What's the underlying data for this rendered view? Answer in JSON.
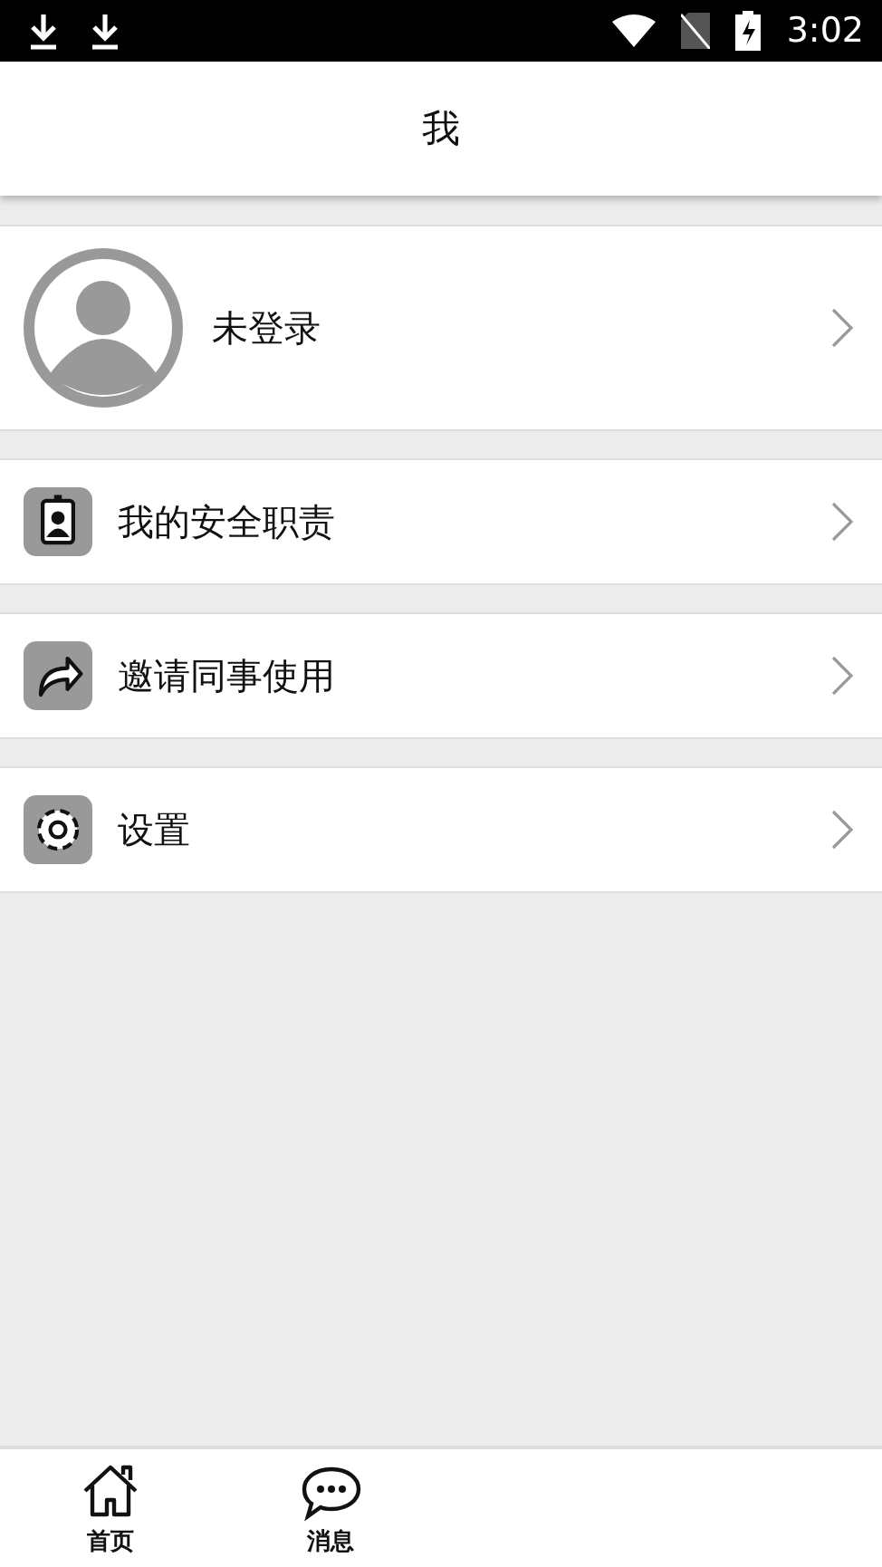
{
  "status_bar": {
    "time": "3:02"
  },
  "header": {
    "title": "我"
  },
  "profile": {
    "name": "未登录"
  },
  "menu": [
    {
      "label": "我的安全职责",
      "kind": "badge"
    },
    {
      "label": "邀请同事使用",
      "kind": "share"
    },
    {
      "label": "设置",
      "kind": "settings"
    }
  ],
  "tab_bar": [
    {
      "label": "首页",
      "kind": "home",
      "selected": false
    },
    {
      "label": "消息",
      "kind": "chat",
      "selected": false
    }
  ]
}
